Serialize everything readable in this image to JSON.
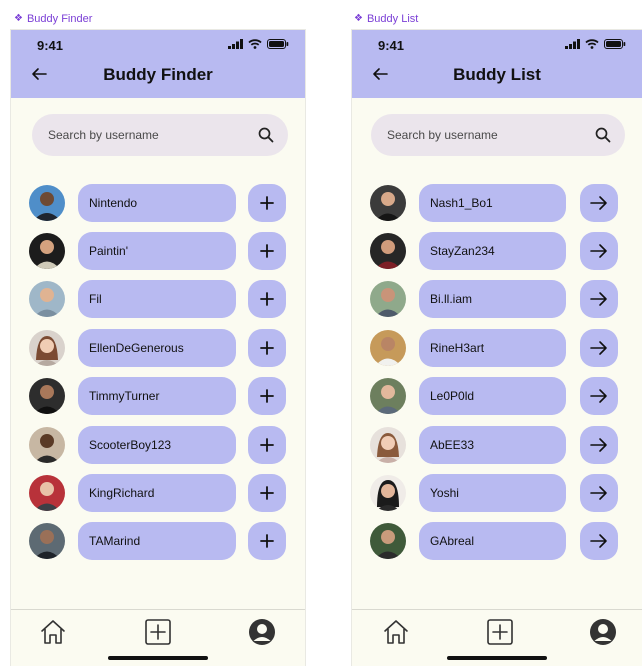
{
  "frames": {
    "left": {
      "label": "Buddy Finder"
    },
    "right": {
      "label": "Buddy List"
    }
  },
  "left": {
    "status_time": "9:41",
    "title": "Buddy Finder",
    "search": {
      "placeholder": "Search by username"
    },
    "items": [
      {
        "username": "Nintendo"
      },
      {
        "username": "Paintin'"
      },
      {
        "username": "Fil"
      },
      {
        "username": "EllenDeGenerous"
      },
      {
        "username": "TimmyTurner"
      },
      {
        "username": "ScooterBoy123"
      },
      {
        "username": "KingRichard"
      },
      {
        "username": "TAMarind"
      }
    ]
  },
  "right": {
    "status_time": "9:41",
    "title": "Buddy List",
    "search": {
      "placeholder": "Search by username"
    },
    "items": [
      {
        "username": "Nash1_Bo1"
      },
      {
        "username": "StayZan234"
      },
      {
        "username": "Bi.ll.iam"
      },
      {
        "username": "RineH3art"
      },
      {
        "username": "Le0P0ld"
      },
      {
        "username": "AbEE33"
      },
      {
        "username": "Yoshi"
      },
      {
        "username": "GAbreal"
      }
    ]
  },
  "icons": {
    "back": "arrow-left-icon",
    "search": "search-icon",
    "add": "plus-icon",
    "navigate": "arrow-right-icon",
    "home": "home-icon",
    "create": "plus-square-icon",
    "profile": "user-circle-icon"
  },
  "colors": {
    "accent": "#b8baf1",
    "background": "#fbfbf1",
    "frame_label": "#7b3fd6",
    "search_bg": "#ebe5ec"
  }
}
